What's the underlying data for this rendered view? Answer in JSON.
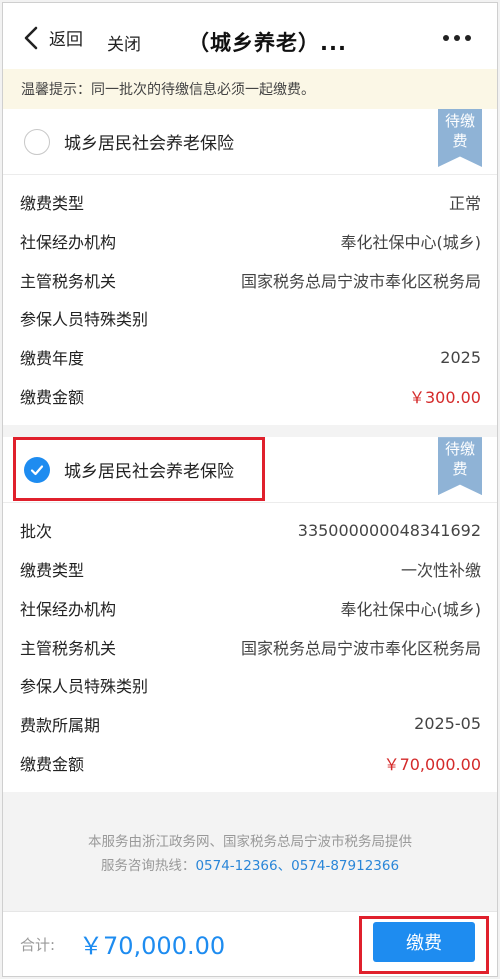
{
  "header": {
    "back_label": "返回",
    "close_label": "关闭",
    "title": "（城乡养老）..."
  },
  "notice": "温馨提示：同一批次的待缴信息必须一起缴费。",
  "cards": [
    {
      "title": "城乡居民社会养老保险",
      "checked": false,
      "ribbon": [
        "待缴",
        "费"
      ],
      "rows": [
        {
          "k": "缴费类型",
          "v": "正常"
        },
        {
          "k": "社保经办机构",
          "v": "奉化社保中心(城乡)"
        },
        {
          "k": "主管税务机关",
          "v": "国家税务总局宁波市奉化区税务局"
        },
        {
          "k": "参保人员特殊类别",
          "v": ""
        },
        {
          "k": "缴费年度",
          "v": "2025"
        },
        {
          "k": "缴费金额",
          "v": "￥300.00"
        }
      ]
    },
    {
      "title": "城乡居民社会养老保险",
      "checked": true,
      "ribbon": [
        "待缴",
        "费"
      ],
      "rows": [
        {
          "k": "批次",
          "v": "335000000048341692"
        },
        {
          "k": "缴费类型",
          "v": "一次性补缴"
        },
        {
          "k": "社保经办机构",
          "v": "奉化社保中心(城乡)"
        },
        {
          "k": "主管税务机关",
          "v": "国家税务总局宁波市奉化区税务局"
        },
        {
          "k": "参保人员特殊类别",
          "v": ""
        },
        {
          "k": "费款所属期",
          "v": "2025-05"
        },
        {
          "k": "缴费金额",
          "v": "￥70,000.00"
        }
      ]
    }
  ],
  "footer": {
    "provider": "本服务由浙江政务网、国家税务总局宁波市税务局提供",
    "hotline_label": "服务咨询热线：",
    "hotline_numbers": "0574-12366、0574-87912366"
  },
  "bottom": {
    "total_label": "合计:",
    "total_value": "￥70,000.00",
    "pay_label": "缴费"
  },
  "colors": {
    "accent": "#1e8cf0",
    "amount_red": "#d42a2a",
    "ribbon": "#8fb3d6",
    "highlight": "#e0202c"
  }
}
